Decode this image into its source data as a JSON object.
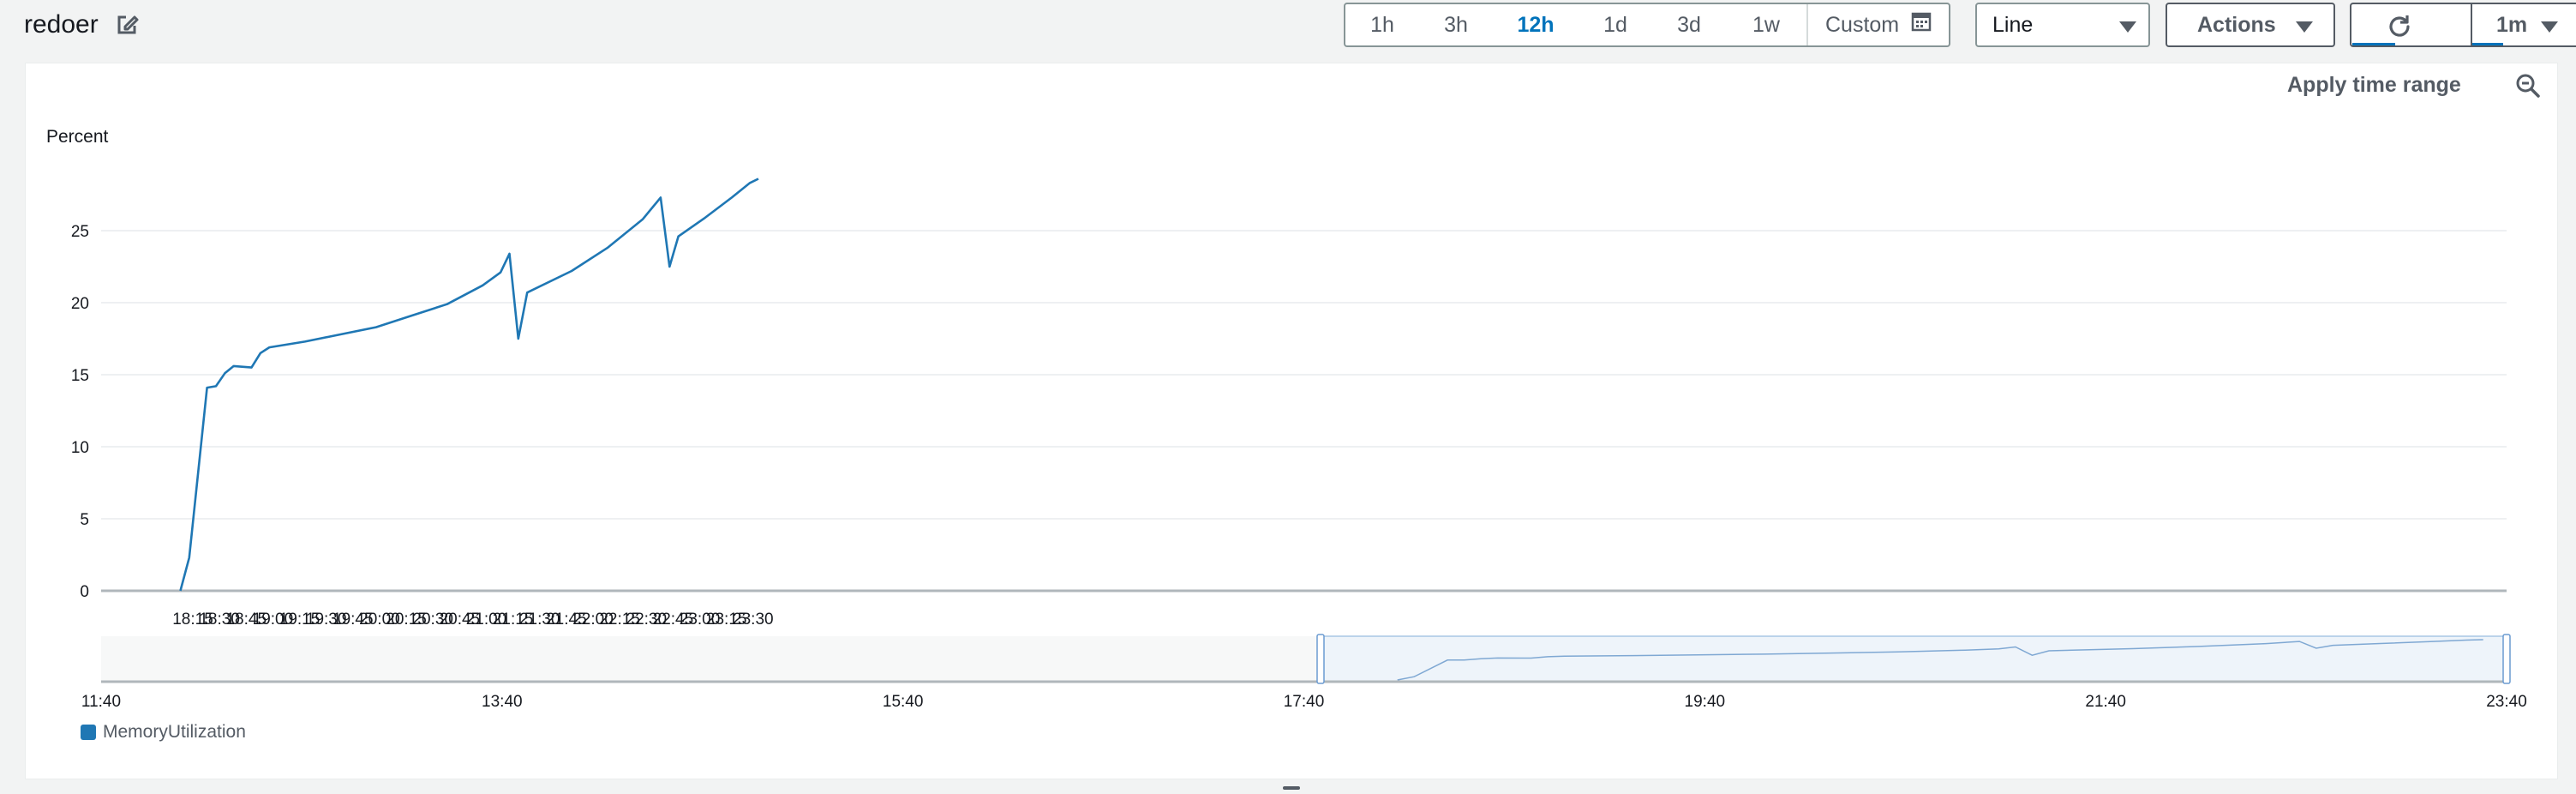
{
  "widget": {
    "title": "redoer"
  },
  "time_range": {
    "options": [
      "1h",
      "3h",
      "12h",
      "1d",
      "3d",
      "1w"
    ],
    "selected": "12h",
    "custom_label": "Custom"
  },
  "view_select": {
    "value": "Line"
  },
  "actions_label": "Actions",
  "refresh_interval": "1m",
  "apply_time_range_label": "Apply time range",
  "unit_label": "Percent",
  "legend": [
    {
      "label": "MemoryUtilization",
      "color": "#1f77b4"
    }
  ],
  "chart_data": {
    "type": "line",
    "ylabel": "Percent",
    "ylim": [
      0,
      30
    ],
    "yticks": [
      0,
      5,
      10,
      15,
      20,
      25
    ],
    "xticks": [
      "18:15",
      "18:30",
      "18:45",
      "19:00",
      "19:15",
      "19:30",
      "19:45",
      "20:00",
      "20:15",
      "20:30",
      "20:45",
      "21:00",
      "21:15",
      "21:30",
      "21:45",
      "22:00",
      "22:15",
      "22:30",
      "22:45",
      "23:00",
      "23:15",
      "23:30"
    ],
    "grid": true,
    "series": [
      {
        "name": "MemoryUtilization",
        "color": "#1f77b4",
        "points": [
          [
            "18:08",
            0.0
          ],
          [
            "18:13",
            2.3
          ],
          [
            "18:23",
            14.1
          ],
          [
            "18:28",
            14.2
          ],
          [
            "18:33",
            15.1
          ],
          [
            "18:38",
            15.6
          ],
          [
            "18:48",
            15.5
          ],
          [
            "18:53",
            16.5
          ],
          [
            "18:58",
            16.9
          ],
          [
            "19:18",
            17.3
          ],
          [
            "19:38",
            17.8
          ],
          [
            "19:58",
            18.3
          ],
          [
            "20:18",
            19.1
          ],
          [
            "20:38",
            19.9
          ],
          [
            "20:58",
            21.2
          ],
          [
            "21:08",
            22.1
          ],
          [
            "21:13",
            23.4
          ],
          [
            "21:18",
            17.5
          ],
          [
            "21:23",
            20.7
          ],
          [
            "21:48",
            22.2
          ],
          [
            "22:08",
            23.8
          ],
          [
            "22:28",
            25.8
          ],
          [
            "22:38",
            27.3
          ],
          [
            "22:43",
            22.5
          ],
          [
            "22:48",
            24.6
          ],
          [
            "23:03",
            25.9
          ],
          [
            "23:18",
            27.3
          ],
          [
            "23:28",
            28.3
          ],
          [
            "23:33",
            28.6
          ]
        ]
      }
    ],
    "overview": {
      "xticks": [
        "11:40",
        "13:40",
        "15:40",
        "17:40",
        "19:40",
        "21:40",
        "23:40"
      ],
      "selection": [
        "17:45",
        "23:40"
      ]
    }
  }
}
